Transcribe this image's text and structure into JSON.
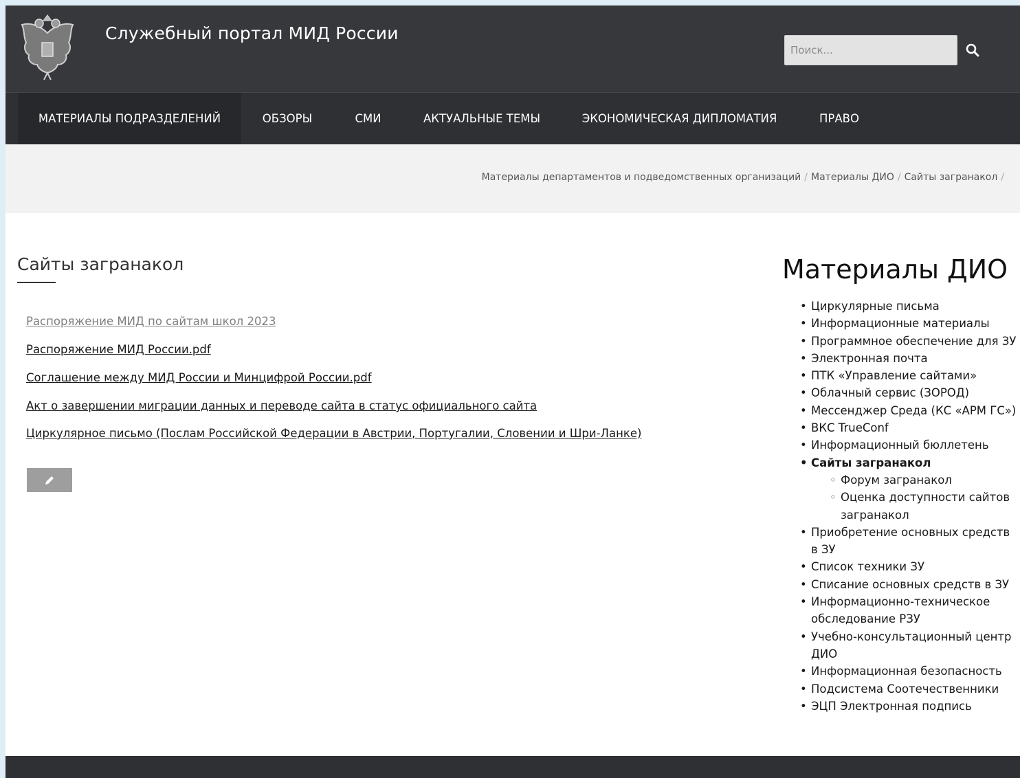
{
  "header": {
    "site_title": "Служебный портал МИД России",
    "search_placeholder": "Поиск..."
  },
  "nav": {
    "items": [
      {
        "label": "МАТЕРИАЛЫ ПОДРАЗДЕЛЕНИЙ",
        "active": true
      },
      {
        "label": "ОБЗОРЫ"
      },
      {
        "label": "СМИ"
      },
      {
        "label": "АКТУАЛЬНЫЕ ТЕМЫ"
      },
      {
        "label": "ЭКОНОМИЧЕСКАЯ ДИПЛОМАТИЯ"
      },
      {
        "label": "ПРАВО"
      }
    ]
  },
  "breadcrumb": [
    "Материалы департаментов и подведомственных организаций",
    "Материалы ДИО",
    "Сайты загранакол"
  ],
  "main": {
    "title": "Сайты загранакол",
    "links": [
      {
        "label": "Распоряжение МИД по сайтам школ 2023 ",
        "visited": true
      },
      {
        "label": "Распоряжение МИД России.pdf"
      },
      {
        "label": "Соглашение между МИД России и Минцифрой России.pdf"
      },
      {
        "label": "Акт о завершении миграции данных и переводе сайта в статус официального сайта "
      },
      {
        "label": "Циркулярное письмо (Послам Российской Федерации в Австрии, Португалии, Словении и Шри-Ланке)"
      }
    ]
  },
  "sidebar": {
    "title": "Материалы ДИО",
    "items": [
      {
        "label": "Циркулярные письма"
      },
      {
        "label": "Информационные материалы"
      },
      {
        "label": "Программное обеспечение для ЗУ"
      },
      {
        "label": "Электронная почта"
      },
      {
        "label": "ПТК «Управление сайтами»"
      },
      {
        "label": "Облачный сервис (ЗОРОД)"
      },
      {
        "label": "Мессенджер Среда (КС «АРМ ГС»)"
      },
      {
        "label": "ВКС TrueConf"
      },
      {
        "label": "Информационный бюллетень"
      },
      {
        "label": "Сайты загранакол",
        "current": true,
        "children": [
          {
            "label": "Форум загранакол"
          },
          {
            "label": "Оценка доступности сайтов загранакол"
          }
        ]
      },
      {
        "label": "Приобретение основных средств в ЗУ"
      },
      {
        "label": "Список техники ЗУ"
      },
      {
        "label": "Списание основных средств в ЗУ"
      },
      {
        "label": "Информационно-техническое обследование РЗУ"
      },
      {
        "label": "Учебно-консультационный центр ДИО"
      },
      {
        "label": "Информационная безопасность"
      },
      {
        "label": "Подсистема Соотечественники"
      },
      {
        "label": "ЭЦП Электронная подпись"
      }
    ]
  },
  "icons": {
    "search": "search-icon",
    "edit": "pencil-icon",
    "logo": "coat-of-arms-logo"
  },
  "colors": {
    "header_bg": "#37383c",
    "nav_bg": "#2f3033",
    "breadcrumb_bg": "#f2f2f2",
    "edit_button_bg": "#9e9e9e"
  }
}
